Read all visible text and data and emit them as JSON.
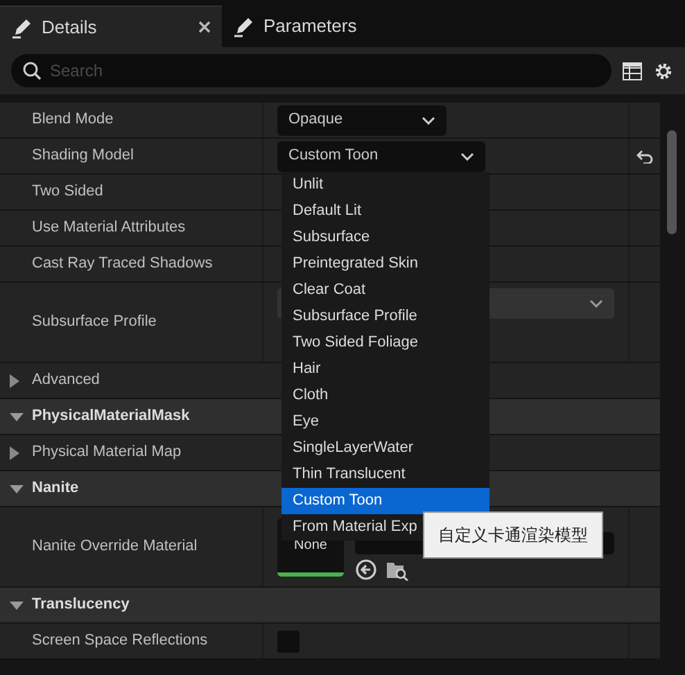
{
  "tabs": [
    {
      "label": "Details",
      "selected": true,
      "closable": true
    },
    {
      "label": "Parameters",
      "selected": false,
      "closable": false
    }
  ],
  "search": {
    "placeholder": "Search"
  },
  "properties": [
    {
      "kind": "property",
      "name": "Blend Mode",
      "value": {
        "kind": "combo",
        "text": "Opaque"
      }
    },
    {
      "kind": "property",
      "name": "Shading Model",
      "value": {
        "kind": "combo",
        "text": "Custom Toon",
        "open": true
      },
      "reset": true
    },
    {
      "kind": "property",
      "name": "Two Sided"
    },
    {
      "kind": "property",
      "name": "Use Material Attributes"
    },
    {
      "kind": "property",
      "name": "Cast Ray Traced Shadows"
    },
    {
      "kind": "property",
      "name": "Subsurface Profile",
      "value": {
        "kind": "combo-wide"
      }
    },
    {
      "kind": "group",
      "name": "Advanced",
      "expanded": false
    },
    {
      "kind": "category",
      "name": "PhysicalMaterialMask",
      "expanded": true
    },
    {
      "kind": "group",
      "name": "Physical Material Map",
      "expanded": false
    },
    {
      "kind": "category",
      "name": "Nanite",
      "expanded": true
    },
    {
      "kind": "property",
      "name": "Nanite Override Material",
      "value": {
        "kind": "asset",
        "thumbnail": "None"
      }
    },
    {
      "kind": "category",
      "name": "Translucency",
      "expanded": true
    },
    {
      "kind": "property",
      "name": "Screen Space Reflections",
      "value": {
        "kind": "checkbox",
        "checked": false
      }
    }
  ],
  "dropdown": {
    "items": [
      {
        "label": "Unlit",
        "selected": false
      },
      {
        "label": "Default Lit",
        "selected": false
      },
      {
        "label": "Subsurface",
        "selected": false
      },
      {
        "label": "Preintegrated Skin",
        "selected": false
      },
      {
        "label": "Clear Coat",
        "selected": false
      },
      {
        "label": "Subsurface Profile",
        "selected": false
      },
      {
        "label": "Two Sided Foliage",
        "selected": false
      },
      {
        "label": "Hair",
        "selected": false
      },
      {
        "label": "Cloth",
        "selected": false
      },
      {
        "label": "Eye",
        "selected": false
      },
      {
        "label": "SingleLayerWater",
        "selected": false
      },
      {
        "label": "Thin Translucent",
        "selected": false
      },
      {
        "label": "Custom Toon",
        "selected": true
      },
      {
        "label": "From Material Exp",
        "selected": false
      }
    ]
  },
  "tooltip": "自定义卡通渲染模型"
}
